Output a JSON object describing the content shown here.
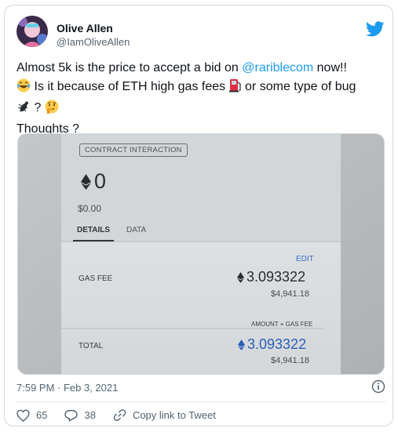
{
  "author": {
    "name": "Olive Allen",
    "handle": "@IamOliveAllen"
  },
  "tweet": {
    "line1_a": "Almost 5k is the price to accept a bid on ",
    "mention": "@rariblecom",
    "line1_b": " now!!",
    "line2_a": " Is it because of ETH high gas fees",
    "line2_b": " or some type of bug",
    "line3_b": " ? ",
    "line4": "Thoughts ?"
  },
  "screenshot": {
    "badge": "CONTRACT INTERACTION",
    "eth_amount": "0",
    "usd_amount": "$0.00",
    "tab_details": "DETAILS",
    "tab_data": "DATA",
    "edit": "EDIT",
    "gas_fee_label": "GAS FEE",
    "gas_fee_eth": "3.093322",
    "gas_fee_usd": "$4,941.18",
    "total_caption": "AMOUNT + GAS FEE",
    "total_label": "TOTAL",
    "total_eth": "3.093322",
    "total_usd": "$4,941.18"
  },
  "meta": {
    "timestamp": "7:59 PM · Feb 3, 2021"
  },
  "actions": {
    "likes": "65",
    "replies": "38",
    "copy_link": "Copy link to Tweet"
  },
  "colors": {
    "accent": "#1d9bf0",
    "text": "#0f1419",
    "muted": "#536471"
  }
}
